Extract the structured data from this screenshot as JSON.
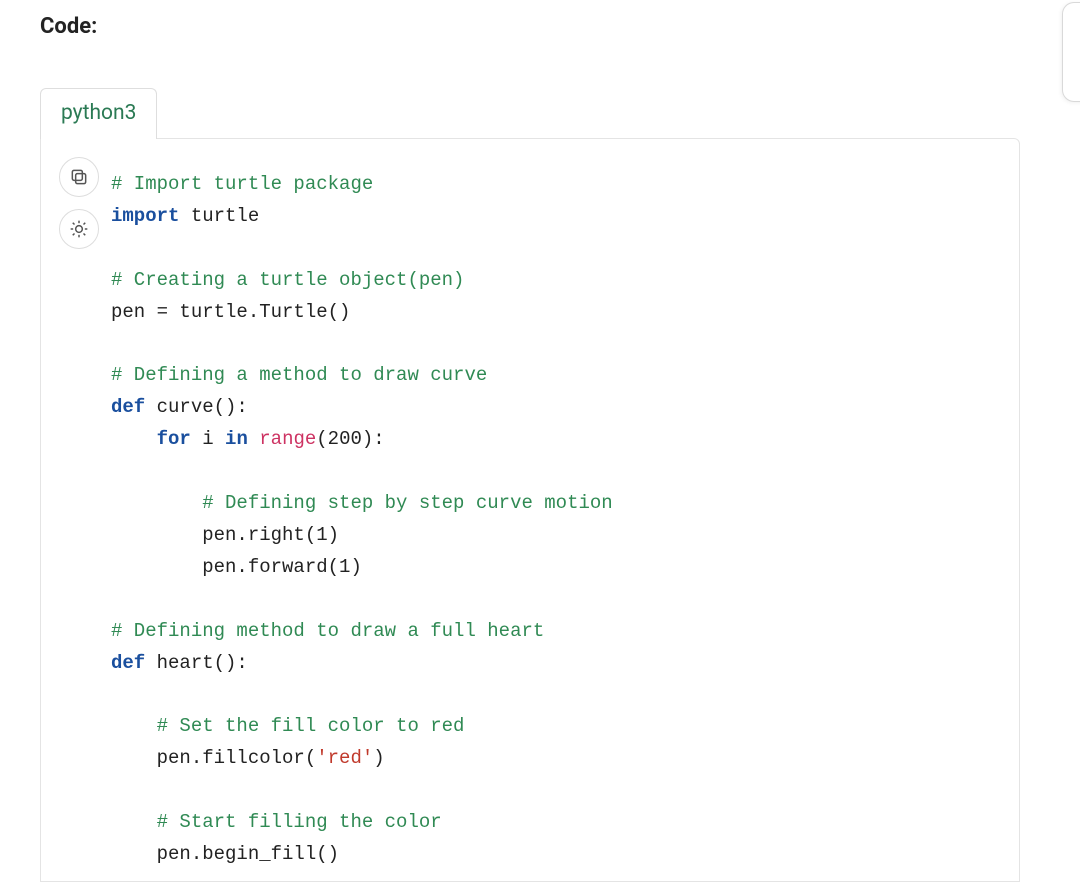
{
  "heading": "Code:",
  "tab_label": "python3",
  "actions": {
    "copy_title": "Copy",
    "theme_title": "Toggle theme"
  },
  "code": {
    "l01_comment": "# Import turtle package",
    "l02_kw": "import",
    "l02_rest": " turtle",
    "l03_blank": "",
    "l04_comment": "# Creating a turtle object(pen)",
    "l05": "pen = turtle.Turtle()",
    "l06_blank": "",
    "l07_comment": "# Defining a method to draw curve",
    "l08_kw": "def",
    "l08_rest": " curve():",
    "l09_kw1": "for",
    "l09_mid": " i ",
    "l09_kw2": "in",
    "l09_sp": " ",
    "l09_bi": "range",
    "l09_tail": "(200):",
    "l10_blank": "",
    "l11_comment": "# Defining step by step curve motion",
    "l12": "pen.right(1)",
    "l13": "pen.forward(1)",
    "l14_blank": "",
    "l15_comment": "# Defining method to draw a full heart",
    "l16_kw": "def",
    "l16_rest": " heart():",
    "l17_blank": "",
    "l18_comment": "# Set the fill color to red",
    "l19_pre": "pen.fillcolor(",
    "l19_str": "'red'",
    "l19_post": ")",
    "l20_blank": "",
    "l21_comment": "# Start filling the color",
    "l22": "pen.begin_fill()",
    "indent1": "    ",
    "indent2": "        "
  }
}
